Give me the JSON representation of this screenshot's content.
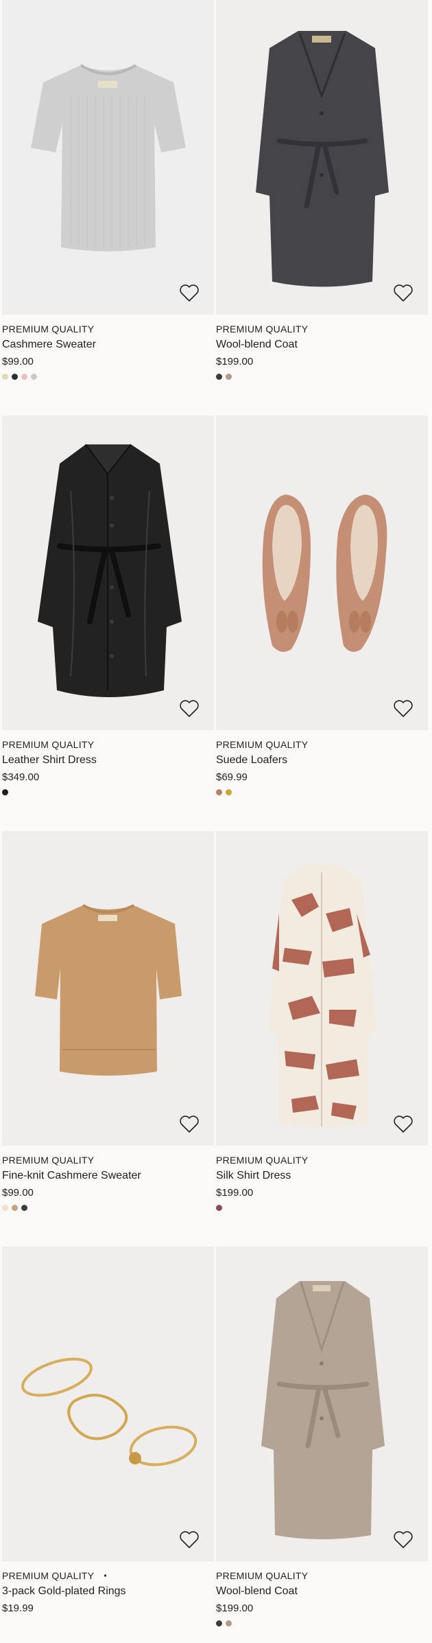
{
  "products": [
    {
      "tag": "PREMIUM QUALITY",
      "title": "Cashmere Sweater",
      "price": "$99.00",
      "bg": "#eeeeee",
      "image_icon": "sweater-icon",
      "swatches": [
        "#e2d9b3",
        "#2a2e38",
        "#e9c2be",
        "#c9c8c8"
      ]
    },
    {
      "tag": "PREMIUM QUALITY",
      "title": "Wool-blend Coat",
      "price": "$199.00",
      "bg": "#efeeec",
      "image_icon": "coat-icon",
      "swatches": [
        "#3b3b3b",
        "#b39a86"
      ]
    },
    {
      "tag": "PREMIUM QUALITY",
      "title": "Leather Shirt Dress",
      "price": "$349.00",
      "bg": "#efeeec",
      "image_icon": "leather-dress-icon",
      "swatches": [
        "#1e1e1e"
      ]
    },
    {
      "tag": "PREMIUM QUALITY",
      "title": "Suede Loafers",
      "price": "$69.99",
      "bg": "#efeeec",
      "image_icon": "loafers-icon",
      "swatches": [
        "#b38366",
        "#cfa52e"
      ]
    },
    {
      "tag": "PREMIUM QUALITY",
      "title": "Fine-knit Cashmere Sweater",
      "price": "$99.00",
      "bg": "#efeeec",
      "image_icon": "knit-sweater-icon",
      "swatches": [
        "#ebe4ca",
        "#c7a582",
        "#3a3f40"
      ]
    },
    {
      "tag": "PREMIUM QUALITY",
      "title": "Silk Shirt Dress",
      "price": "$199.00",
      "bg": "#efeeec",
      "image_icon": "printed-dress-icon",
      "swatches": [
        "#8a4c59"
      ]
    },
    {
      "tag": "PREMIUM QUALITY",
      "tag_dot": "•",
      "title": "3-pack Gold-plated Rings",
      "price": "$19.99",
      "bg": "#efeeec",
      "image_icon": "rings-icon",
      "swatches": []
    },
    {
      "tag": "PREMIUM QUALITY",
      "title": "Wool-blend Coat",
      "price": "$199.00",
      "bg": "#efeeec",
      "image_icon": "camel-coat-icon",
      "swatches": [
        "#3b3b3b",
        "#b39a86"
      ]
    }
  ],
  "favorite_icon": "heart-outline-icon"
}
